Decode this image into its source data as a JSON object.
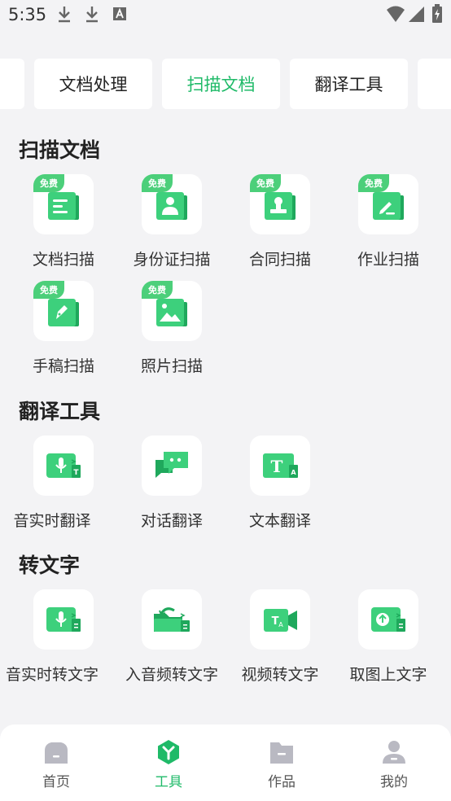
{
  "status_bar": {
    "time": "5:35"
  },
  "tabs": [
    {
      "label": "文档处理",
      "active": false
    },
    {
      "label": "扫描文档",
      "active": true
    },
    {
      "label": "翻译工具",
      "active": false
    }
  ],
  "sections": {
    "scan": {
      "title": "扫描文档",
      "items": [
        {
          "label": "文档扫描",
          "badge": "免费",
          "icon": "document-icon"
        },
        {
          "label": "身份证扫描",
          "badge": "免费",
          "icon": "id-card-icon"
        },
        {
          "label": "合同扫描",
          "badge": "免费",
          "icon": "contract-stamp-icon"
        },
        {
          "label": "作业扫描",
          "badge": "免费",
          "icon": "homework-pen-icon"
        },
        {
          "label": "手稿扫描",
          "badge": "免费",
          "icon": "manuscript-pen-icon"
        },
        {
          "label": "照片扫描",
          "badge": "免费",
          "icon": "photo-icon"
        }
      ]
    },
    "translate": {
      "title": "翻译工具",
      "items": [
        {
          "label": "音实时翻译",
          "icon": "mic-translate-icon"
        },
        {
          "label": "对话翻译",
          "icon": "chat-bubble-icon"
        },
        {
          "label": "文本翻译",
          "icon": "text-translate-icon"
        }
      ]
    },
    "transcribe": {
      "title": "转文字",
      "items": [
        {
          "label": "音实时转文字",
          "icon": "mic-to-text-icon"
        },
        {
          "label": "入音频转文字",
          "icon": "folder-audio-icon"
        },
        {
          "label": "视频转文字",
          "icon": "video-to-text-icon"
        },
        {
          "label": "取图上文字",
          "icon": "image-upload-text-icon"
        }
      ]
    }
  },
  "bottom_nav": [
    {
      "label": "首页",
      "icon": "home-icon",
      "active": false
    },
    {
      "label": "工具",
      "icon": "tools-icon",
      "active": true
    },
    {
      "label": "作品",
      "icon": "folder-icon",
      "active": false
    },
    {
      "label": "我的",
      "icon": "profile-icon",
      "active": false
    }
  ],
  "colors": {
    "accent": "#1fba68",
    "badge": "#4ccf7a",
    "icon_green": "#2ec56f"
  }
}
